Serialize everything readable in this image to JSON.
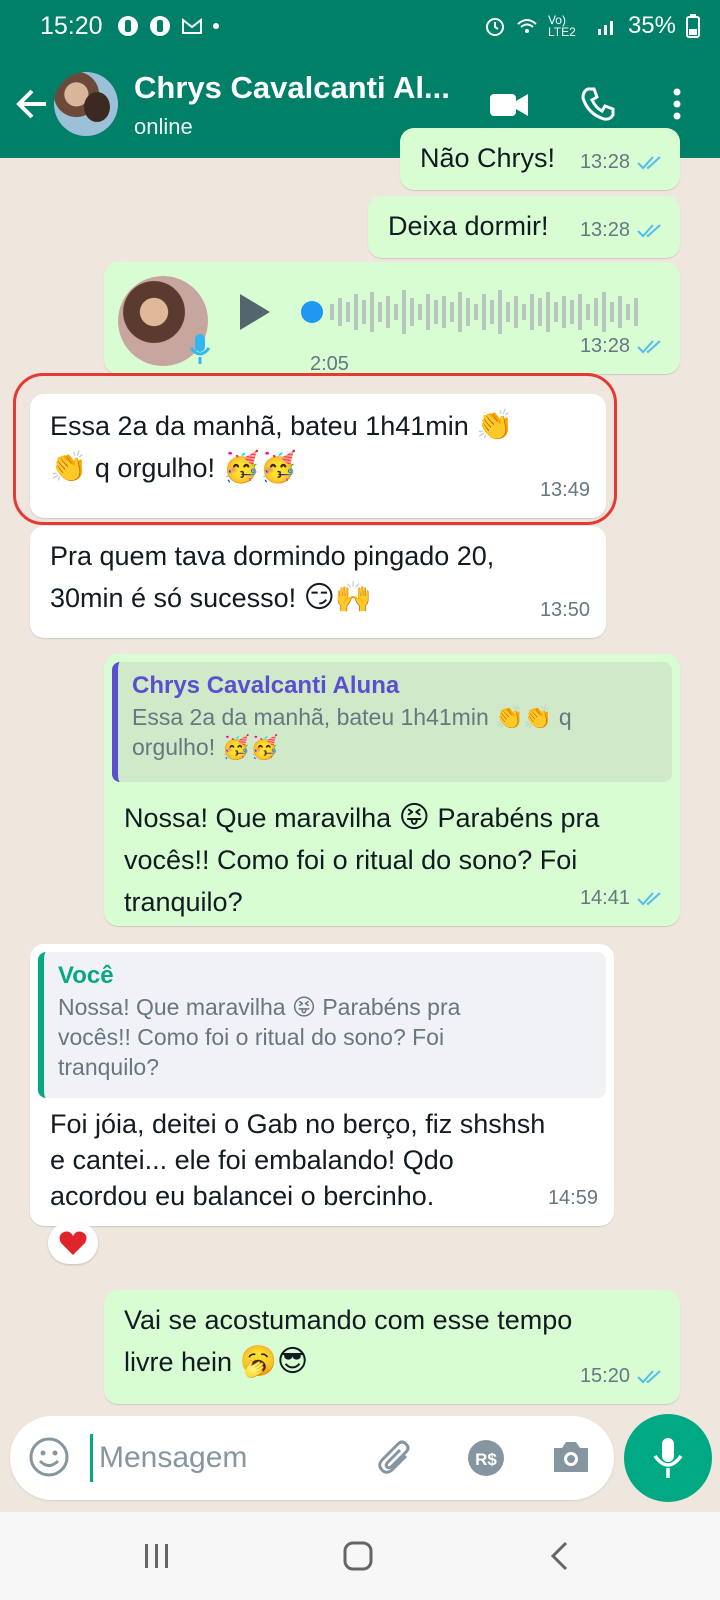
{
  "status_bar": {
    "time": "15:20",
    "battery": "35%",
    "network": "Vo) LTE2"
  },
  "header": {
    "name": "Chrys Cavalcanti Al...",
    "status": "online"
  },
  "messages": [
    {
      "text": "Não Chrys!",
      "time": "13:28"
    },
    {
      "text": "Deixa dormir!",
      "time": "13:28"
    },
    {
      "duration": "2:05",
      "time": "13:28"
    },
    {
      "text_line1": "Essa 2a da manhã, bateu 1h41min",
      "text_line2": "q orgulho!",
      "time": "13:49"
    },
    {
      "text_line1": "Pra quem tava dormindo pingado 20,",
      "text_line2": "30min é só sucesso!",
      "time": "13:50"
    },
    {
      "quote_author": "Chrys Cavalcanti Aluna",
      "quote_line1": "Essa 2a da manhã, bateu 1h41min",
      "quote_line1b": "q",
      "quote_line2": "orgulho!",
      "text_line1": "Nossa! Que maravilha",
      "text_line1b": "Parabéns pra",
      "text_line2": "vocês!! Como foi o ritual do sono? Foi",
      "text_line3": "tranquilo?",
      "time": "14:41"
    },
    {
      "quote_author": "Você",
      "quote_line1": "Nossa! Que maravilha",
      "quote_line1b": "Parabéns pra",
      "quote_line2": "vocês!! Como foi o ritual do sono? Foi",
      "quote_line3": "tranquilo?",
      "text_line1": "Foi jóia, deitei o Gab no berço, fiz shshsh",
      "text_line2": "e cantei... ele foi embalando! Qdo",
      "text_line3": "acordou eu balancei o bercinho.",
      "time": "14:59",
      "reaction": "heart"
    },
    {
      "text_line1": "Vai se acostumando com esse tempo",
      "text_line2": "livre hein",
      "time": "15:20"
    }
  ],
  "input": {
    "placeholder": "Mensagem"
  },
  "colors": {
    "header": "#008069",
    "outgoing": "#d9fdd3",
    "incoming": "#ffffff",
    "accent": "#00a884",
    "highlight": "#e53935"
  }
}
